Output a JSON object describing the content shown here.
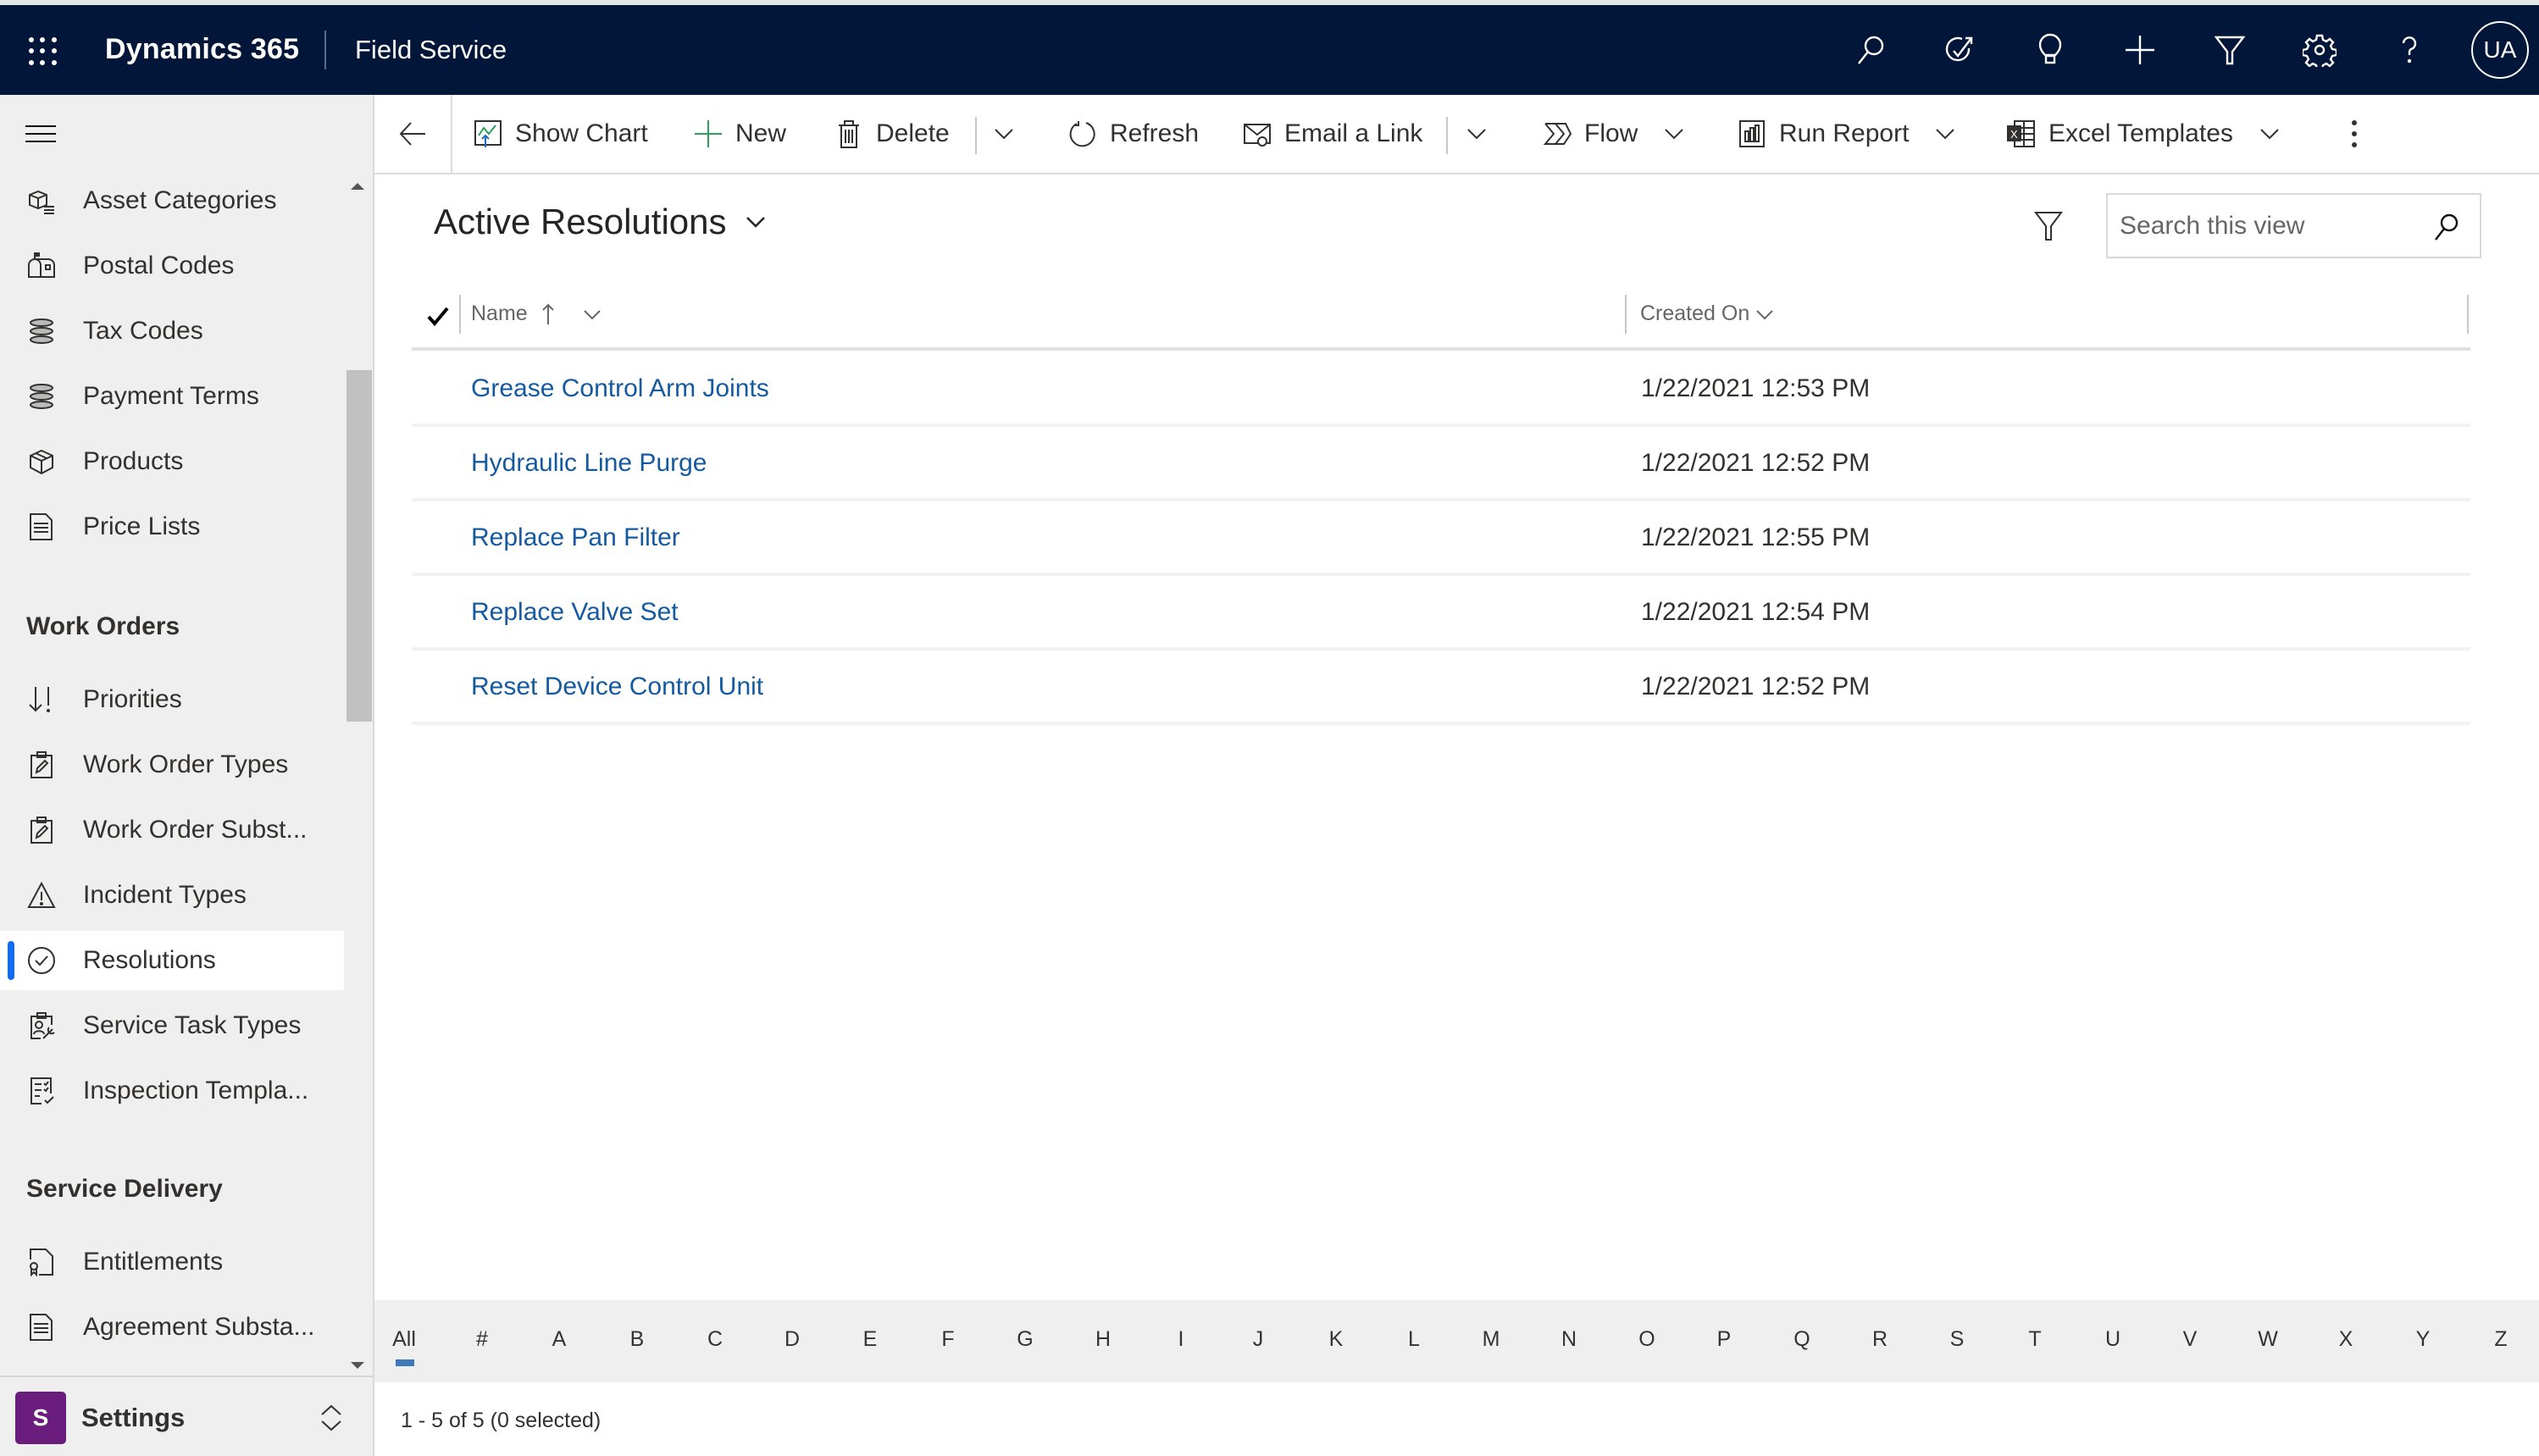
{
  "header": {
    "app_name": "Dynamics 365",
    "area_name": "Field Service",
    "icons": [
      "search-icon",
      "task-flow-icon",
      "lightbulb-icon",
      "plus-icon",
      "filter-icon",
      "gear-icon",
      "help-icon"
    ],
    "user_initials": "UA"
  },
  "sidebar": {
    "groups": [
      {
        "title": "",
        "items": [
          {
            "label": "Asset Categories",
            "icon": "asset-categories-icon"
          },
          {
            "label": "Postal Codes",
            "icon": "mailbox-icon"
          },
          {
            "label": "Tax Codes",
            "icon": "coins-stack-icon"
          },
          {
            "label": "Payment Terms",
            "icon": "coins-stack-icon"
          },
          {
            "label": "Products",
            "icon": "box-icon"
          },
          {
            "label": "Price Lists",
            "icon": "document-list-icon"
          }
        ]
      },
      {
        "title": "Work Orders",
        "items": [
          {
            "label": "Priorities",
            "icon": "priority-icon"
          },
          {
            "label": "Work Order Types",
            "icon": "clipboard-edit-icon"
          },
          {
            "label": "Work Order Subst...",
            "icon": "clipboard-edit-icon"
          },
          {
            "label": "Incident Types",
            "icon": "warning-icon"
          },
          {
            "label": "Resolutions",
            "icon": "check-circle-icon",
            "active": true
          },
          {
            "label": "Service Task Types",
            "icon": "clipboard-wrench-icon"
          },
          {
            "label": "Inspection Templa...",
            "icon": "checklist-icon"
          }
        ]
      },
      {
        "title": "Service Delivery",
        "items": [
          {
            "label": "Entitlements",
            "icon": "certificate-icon"
          },
          {
            "label": "Agreement Substa...",
            "icon": "document-list-icon"
          }
        ]
      }
    ],
    "area_switcher": {
      "badge": "S",
      "label": "Settings",
      "badge_color": "#6b1d7d"
    }
  },
  "toolbar": {
    "show_chart": "Show Chart",
    "new": "New",
    "delete": "Delete",
    "refresh": "Refresh",
    "email_link": "Email a Link",
    "flow": "Flow",
    "run_report": "Run Report",
    "excel_templates": "Excel Templates"
  },
  "view": {
    "title": "Active Resolutions",
    "search_placeholder": "Search this view",
    "search_value": ""
  },
  "grid": {
    "columns": [
      {
        "label": "Name",
        "sort": "ascending"
      },
      {
        "label": "Created On"
      }
    ],
    "rows": [
      {
        "name": "Grease Control Arm Joints",
        "created_on": "1/22/2021 12:53 PM"
      },
      {
        "name": "Hydraulic Line Purge",
        "created_on": "1/22/2021 12:52 PM"
      },
      {
        "name": "Replace Pan Filter",
        "created_on": "1/22/2021 12:55 PM"
      },
      {
        "name": "Replace Valve Set",
        "created_on": "1/22/2021 12:54 PM"
      },
      {
        "name": "Reset Device Control Unit",
        "created_on": "1/22/2021 12:52 PM"
      }
    ]
  },
  "alphabet": {
    "items": [
      "All",
      "#",
      "A",
      "B",
      "C",
      "D",
      "E",
      "F",
      "G",
      "H",
      "I",
      "J",
      "K",
      "L",
      "M",
      "N",
      "O",
      "P",
      "Q",
      "R",
      "S",
      "T",
      "U",
      "V",
      "W",
      "X",
      "Y",
      "Z"
    ],
    "selected": "All"
  },
  "footer": {
    "status": "1 - 5 of 5 (0 selected)"
  },
  "colors": {
    "nav_bar": "#011638",
    "link": "#155aa0",
    "active_indicator": "#0f6cf7",
    "sidebar_bg": "#efefef"
  }
}
